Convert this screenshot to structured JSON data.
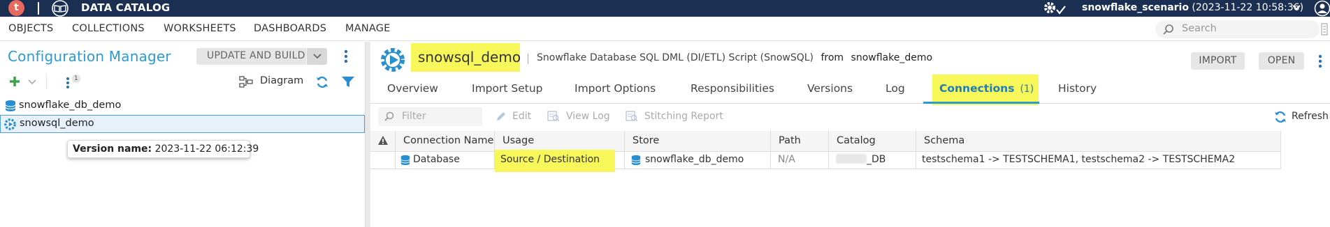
{
  "topbar": {
    "logo_letter": "t",
    "app_title": "DATA CATALOG",
    "scenario_name": "snowflake_scenario",
    "scenario_time": "(2023-11-22 10:58:36)"
  },
  "menu": {
    "items": [
      "OBJECTS",
      "COLLECTIONS",
      "WORKSHEETS",
      "DASHBOARDS",
      "MANAGE"
    ],
    "search_placeholder": "Search"
  },
  "left_panel": {
    "title": "Configuration Manager",
    "update_build_label": "UPDATE AND BUILD",
    "version_badge": "1",
    "diagram_label": "Diagram",
    "tree": [
      {
        "label": "snowflake_db_demo",
        "icon": "database-icon",
        "selected": false
      },
      {
        "label": "snowsql_demo",
        "icon": "gear-play-icon",
        "selected": true
      }
    ],
    "tooltip": {
      "label": "Version name:",
      "value": "2023-11-22 06:12:39"
    }
  },
  "header": {
    "name": "snowsql_demo",
    "description": "Snowflake Database SQL DML (DI/ETL) Script (SnowSQL)",
    "from_label": "from",
    "source": "snowflake_demo",
    "import_label": "IMPORT",
    "open_label": "OPEN"
  },
  "tabs": {
    "items": [
      "Overview",
      "Import Setup",
      "Import Options",
      "Responsibilities",
      "Versions",
      "Log",
      "Connections",
      "History"
    ],
    "active": "Connections",
    "active_count": "(1)"
  },
  "toolbar": {
    "filter_placeholder": "Filter",
    "edit_label": "Edit",
    "view_log_label": "View Log",
    "stitching_label": "Stitching Report",
    "refresh_label": "Refresh"
  },
  "grid": {
    "columns": [
      "Connection Name",
      "Usage",
      "Store",
      "Path",
      "Catalog",
      "Schema"
    ],
    "rows": [
      {
        "connection_name": "Database",
        "usage": "Source / Destination",
        "store": "snowflake_db_demo",
        "path": "N/A",
        "catalog": "_DB",
        "schema": "testschema1 -> TESTSCHEMA1, testschema2 -> TESTSCHEMA2"
      }
    ]
  },
  "colors": {
    "topbar": "#1b2f52",
    "accent": "#2a9bd3",
    "highlight": "#f7f75a",
    "logo": "#e8695f"
  }
}
